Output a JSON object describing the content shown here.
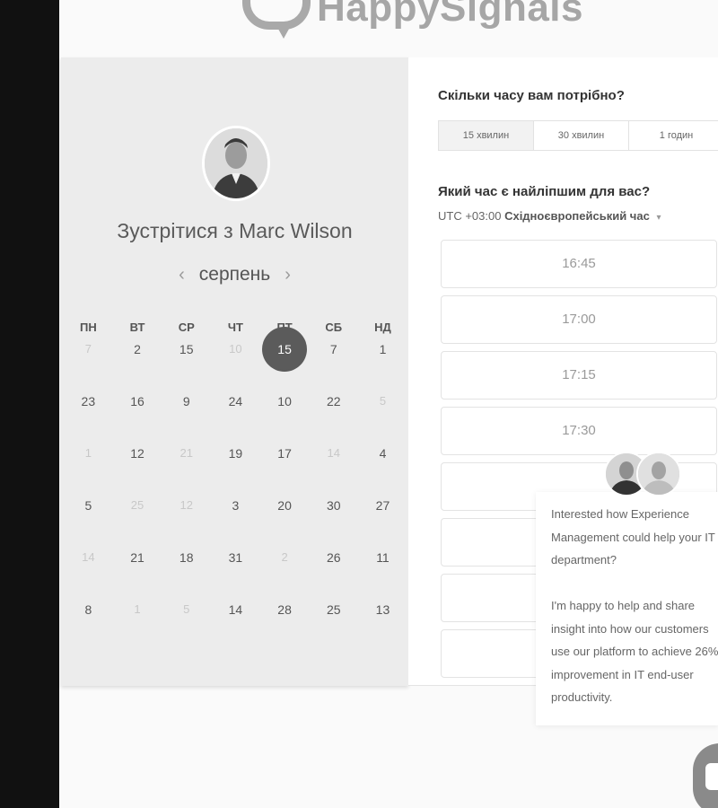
{
  "brand": {
    "name": "HappySignals"
  },
  "host": {
    "meet_title": "Зустрітися з Marc Wilson"
  },
  "calendar": {
    "month": "серпень",
    "prev_icon": "‹",
    "next_icon": "›",
    "weekdays": [
      "ПН",
      "ВТ",
      "СР",
      "ЧТ",
      "ПТ",
      "СБ",
      "НД"
    ],
    "selected_day": "15",
    "weeks": [
      [
        {
          "d": "7",
          "dim": true
        },
        {
          "d": "2",
          "dim": false
        },
        {
          "d": "15",
          "dim": false
        },
        {
          "d": "10",
          "dim": true
        },
        {
          "d": "15",
          "dim": false,
          "selected": true
        },
        {
          "d": "7",
          "dim": false
        },
        {
          "d": "1",
          "dim": false
        }
      ],
      [
        {
          "d": "23",
          "dim": false
        },
        {
          "d": "16",
          "dim": false
        },
        {
          "d": "9",
          "dim": false
        },
        {
          "d": "24",
          "dim": false
        },
        {
          "d": "10",
          "dim": false
        },
        {
          "d": "22",
          "dim": false
        },
        {
          "d": "5",
          "dim": true
        }
      ],
      [
        {
          "d": "1",
          "dim": true
        },
        {
          "d": "12",
          "dim": false
        },
        {
          "d": "21",
          "dim": true
        },
        {
          "d": "19",
          "dim": false
        },
        {
          "d": "17",
          "dim": false
        },
        {
          "d": "14",
          "dim": true
        },
        {
          "d": "4",
          "dim": false
        }
      ],
      [
        {
          "d": "5",
          "dim": false
        },
        {
          "d": "25",
          "dim": true
        },
        {
          "d": "12",
          "dim": true
        },
        {
          "d": "3",
          "dim": false
        },
        {
          "d": "20",
          "dim": false
        },
        {
          "d": "30",
          "dim": false
        },
        {
          "d": "27",
          "dim": false
        }
      ],
      [
        {
          "d": "14",
          "dim": true
        },
        {
          "d": "21",
          "dim": false
        },
        {
          "d": "18",
          "dim": false
        },
        {
          "d": "31",
          "dim": false
        },
        {
          "d": "2",
          "dim": true
        },
        {
          "d": "26",
          "dim": false
        },
        {
          "d": "11",
          "dim": false
        }
      ],
      [
        {
          "d": "8",
          "dim": false
        },
        {
          "d": "1",
          "dim": true
        },
        {
          "d": "5",
          "dim": true
        },
        {
          "d": "14",
          "dim": false
        },
        {
          "d": "28",
          "dim": false
        },
        {
          "d": "25",
          "dim": false
        },
        {
          "d": "13",
          "dim": false
        }
      ]
    ]
  },
  "scheduler": {
    "duration_question": "Скільки часу вам потрібно?",
    "durations": [
      "15 хвилин",
      "30 хвилин",
      "1 годин"
    ],
    "time_question": "Який час є найліпшим для вас?",
    "timezone_offset": "UTC +03:00",
    "timezone_name": "Східноєвропейський час",
    "caret_icon": "▾",
    "slots": [
      "16:45",
      "17:00",
      "17:15",
      "17:30",
      "",
      "",
      "",
      ""
    ]
  },
  "chat": {
    "message": "Interested how Experience Management could help your IT department?\n\nI'm happy to help and share insight into how our customers use our platform to achieve 26% improvement in IT end-user productivity."
  }
}
